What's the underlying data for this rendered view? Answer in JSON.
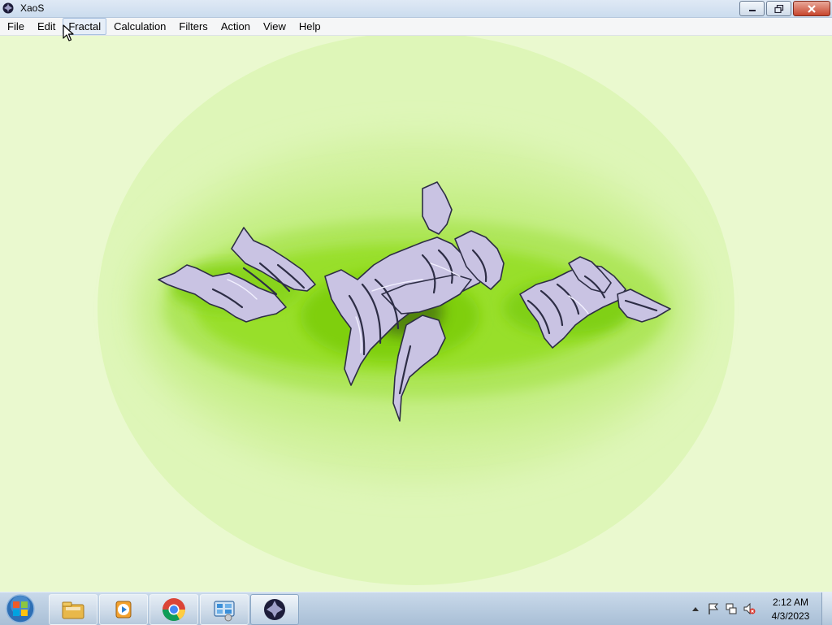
{
  "window": {
    "title": "XaoS",
    "app_icon": "xaos-icon",
    "controls": [
      "minimize-icon",
      "restore-icon",
      "close-icon"
    ]
  },
  "menu": {
    "items": [
      "File",
      "Edit",
      "Fractal",
      "Calculation",
      "Filters",
      "Action",
      "View",
      "Help"
    ],
    "hovered": "Fractal"
  },
  "canvas": {
    "background_color": "#eaf9cf",
    "glow_color": "#8fdf16",
    "fractal_color": "#c9c3e3",
    "fractal_outline": "#2d2d45"
  },
  "taskbar": {
    "buttons": [
      "start-orb-icon",
      "file-explorer-icon",
      "media-player-icon",
      "chrome-icon",
      "control-panel-icon",
      "xaos-icon"
    ],
    "active": "xaos-icon",
    "tray_icons": [
      "show-hidden-icons",
      "action-center-flag-icon",
      "network-icon",
      "volume-muted-icon"
    ],
    "clock": {
      "time": "2:12 AM",
      "date": "4/3/2023"
    }
  }
}
